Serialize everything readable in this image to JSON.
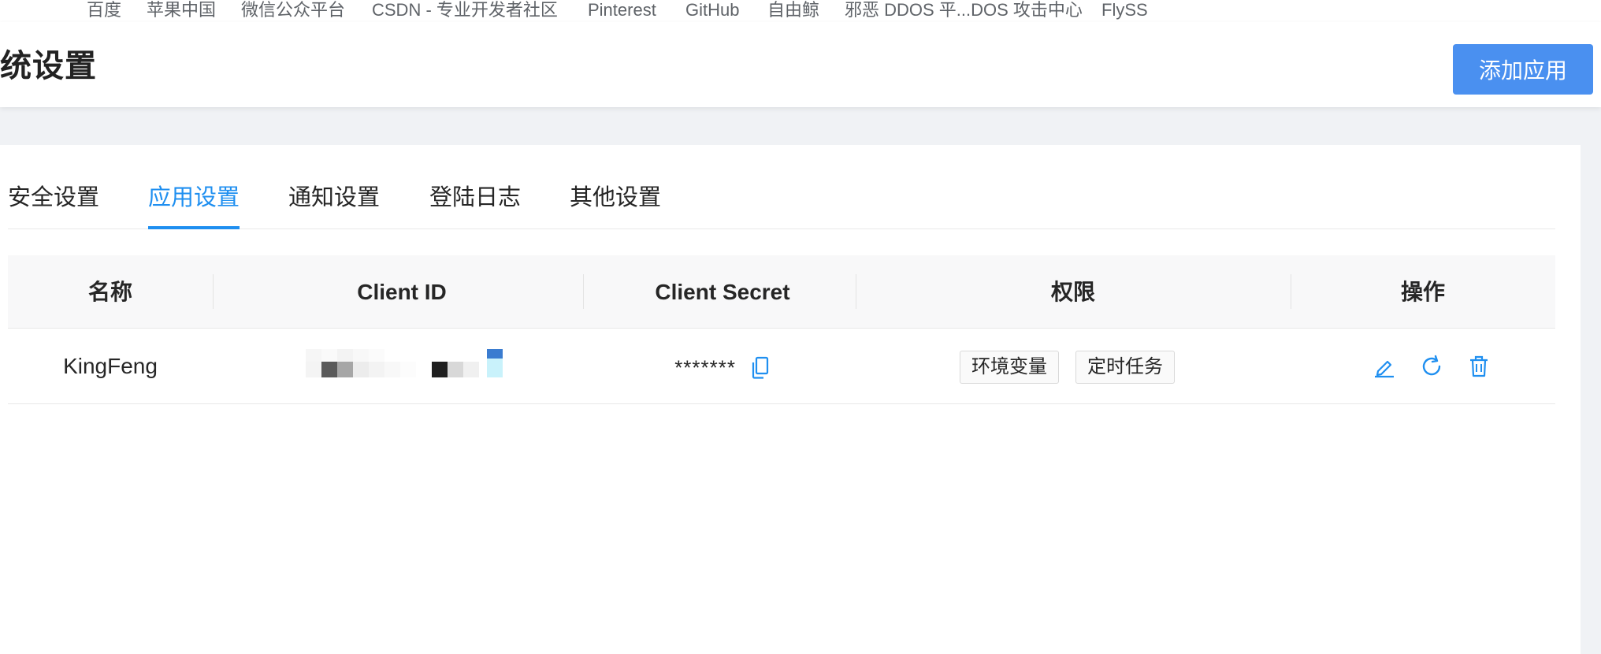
{
  "bookmarks": [
    "百度",
    "苹果中国",
    "微信公众平台",
    "CSDN - 专业开发者社区",
    "Pinterest",
    "GitHub",
    "自由鲸",
    "邪恶 DDOS 平...DOS 攻击中心",
    "FlySS"
  ],
  "header": {
    "title": "统设置",
    "add_button": "添加应用"
  },
  "tabs": [
    "安全设置",
    "应用设置",
    "通知设置",
    "登陆日志",
    "其他设置"
  ],
  "active_tab": "应用设置",
  "table": {
    "columns": [
      "名称",
      "Client ID",
      "Client Secret",
      "权限",
      "操作"
    ],
    "rows": [
      {
        "name": "KingFeng",
        "client_secret": "*******",
        "permissions": [
          "环境变量",
          "定时任务"
        ]
      }
    ]
  },
  "colors": {
    "accent": "#1f8ff0",
    "primary_button": "#4a90f0",
    "page_bg": "#f0f2f5"
  },
  "icons": {
    "copy": "copy-icon",
    "edit": "edit-icon",
    "reset": "refresh-icon",
    "delete": "trash-icon"
  }
}
